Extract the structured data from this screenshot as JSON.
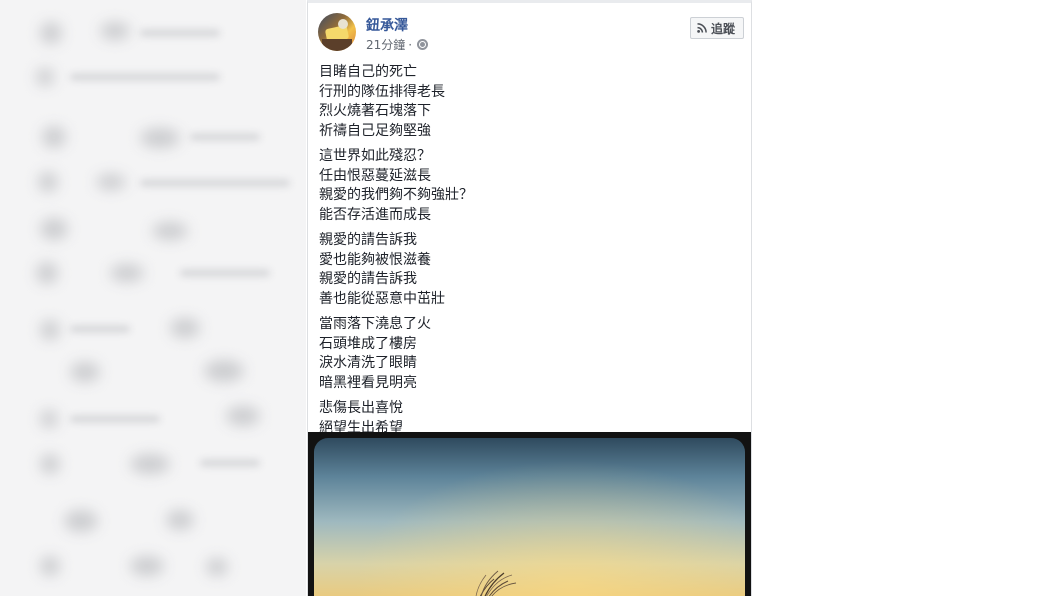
{
  "post": {
    "author": "鈕承澤",
    "timestamp": "21分鐘",
    "separator": "·",
    "privacy_icon": "globe-icon",
    "follow_label": "追蹤",
    "follow_icon": "rss-icon",
    "stanzas": [
      [
        "目睹自己的死亡",
        "行刑的隊伍排得老長",
        "烈火燒著石塊落下",
        "祈禱自己足夠堅強"
      ],
      [
        "這世界如此殘忍？",
        "任由恨惡蔓延滋長",
        "親愛的我們夠不夠強壯？",
        "能否存活進而成長"
      ],
      [
        "親愛的請告訴我",
        "愛也能夠被恨滋養",
        "親愛的請告訴我",
        "善也能從惡意中茁壯"
      ],
      [
        "當雨落下澆息了火",
        "石頭堆成了樓房",
        "淚水清洗了眼睛",
        "暗黑裡看見明亮"
      ],
      [
        "悲傷長出喜悅",
        "絕望生出希望"
      ]
    ]
  },
  "colors": {
    "author_link": "#365899",
    "meta_text": "#616770",
    "body_text": "#1d2129",
    "button_bg": "#f5f6f7",
    "button_border": "#ccd0d5"
  }
}
